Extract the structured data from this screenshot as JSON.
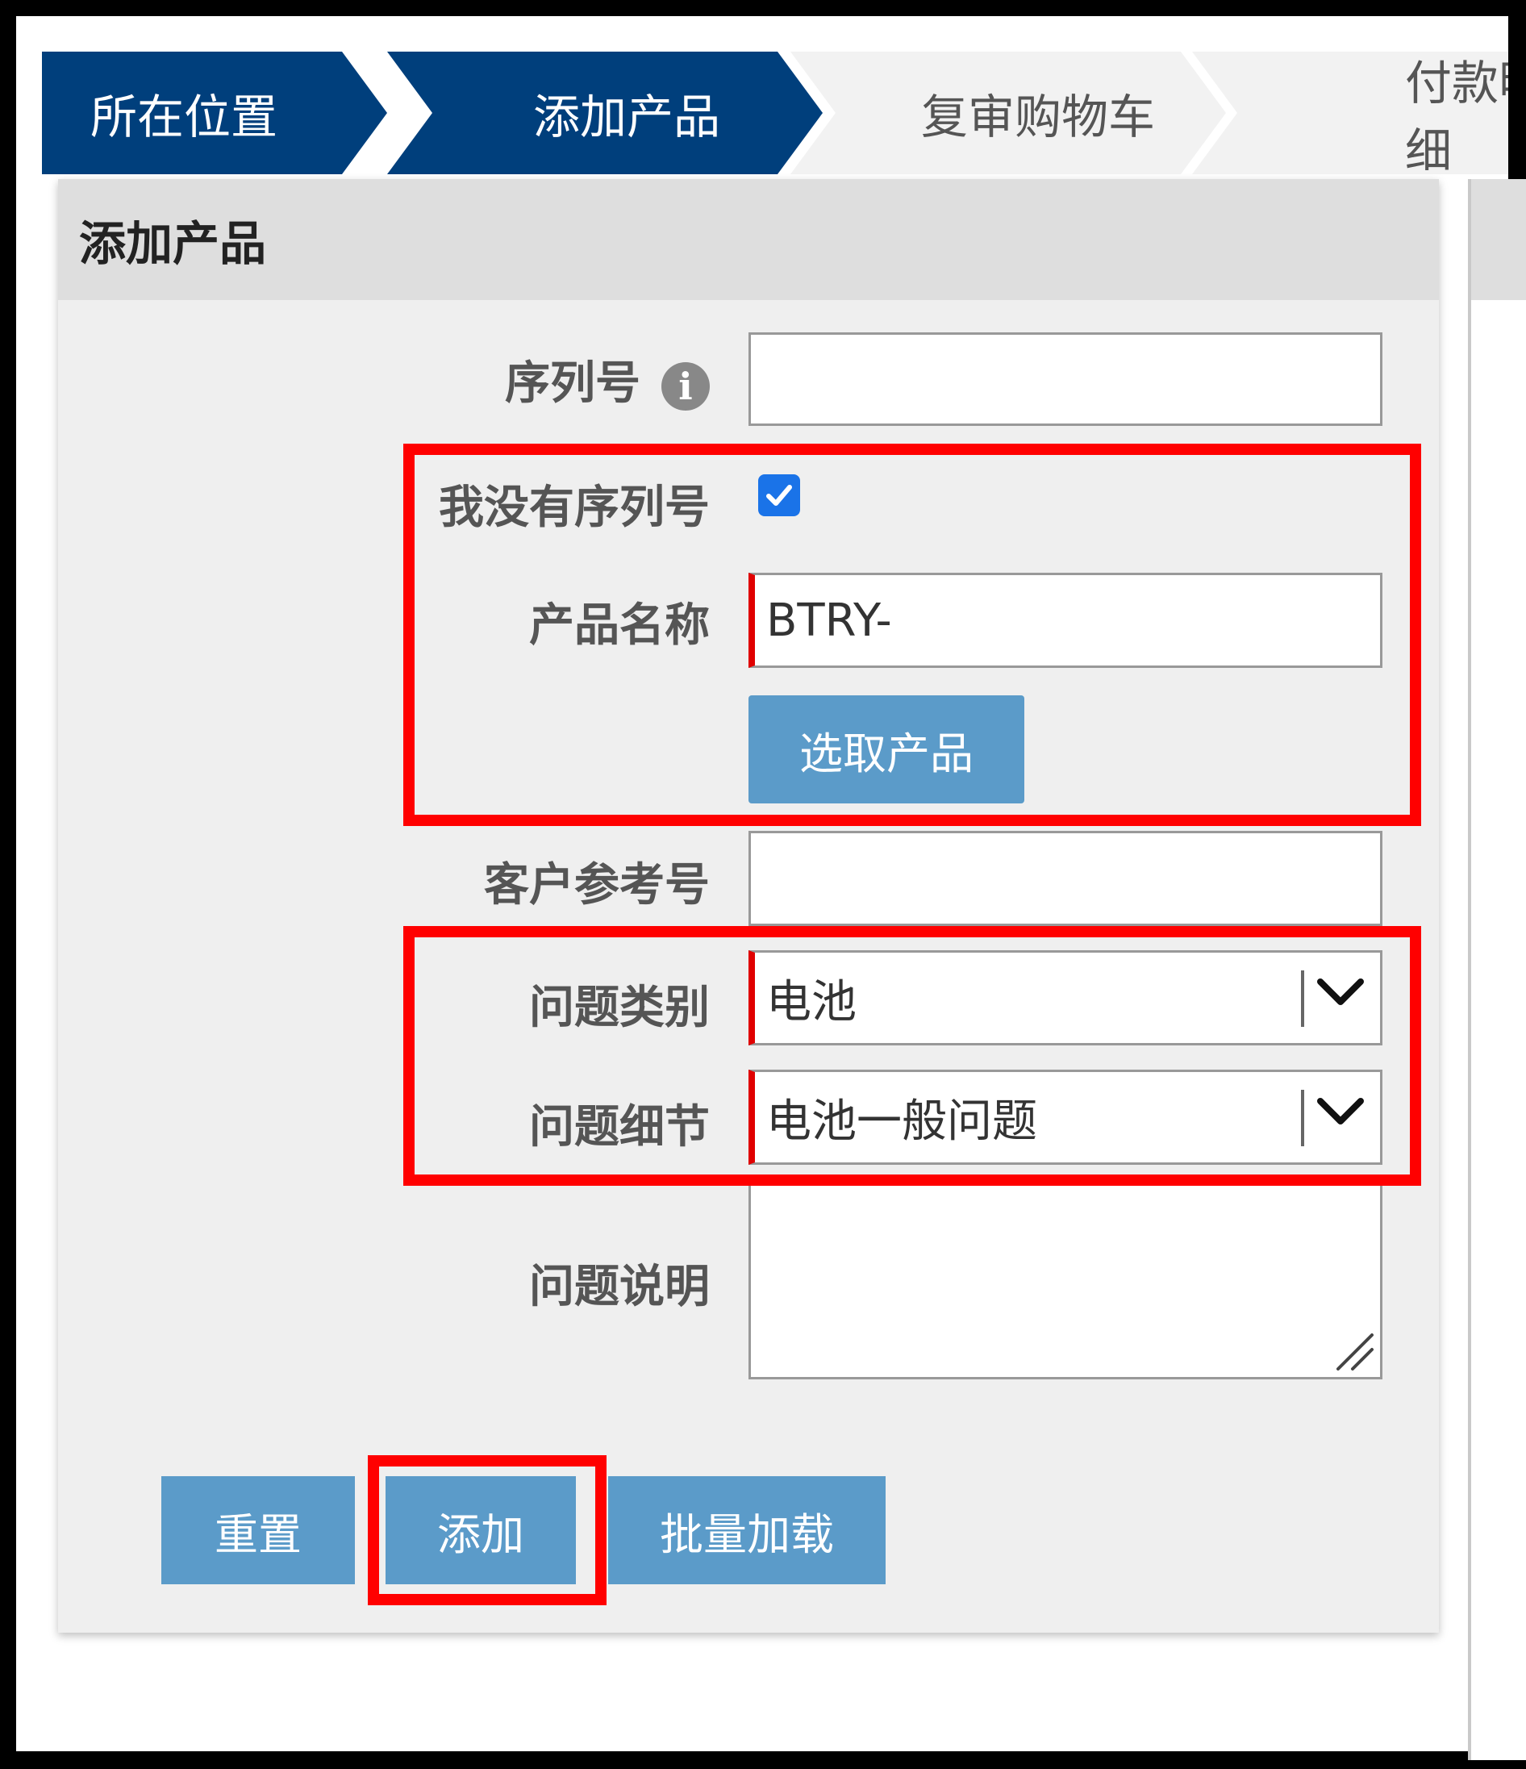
{
  "steps": [
    {
      "label": "所在位置",
      "state": "done"
    },
    {
      "label": "添加产品",
      "state": "current"
    },
    {
      "label": "复审购物车",
      "state": "todo"
    },
    {
      "label": "付款明细",
      "state": "todo"
    }
  ],
  "panel": {
    "title": "添加产品",
    "serial_label": "序列号",
    "serial_value": "",
    "no_serial_label": "我没有序列号",
    "no_serial_checked": true,
    "product_name_label": "产品名称",
    "product_name_value": "BTRY-",
    "select_product_button": "选取产品",
    "customer_ref_label": "客户参考号",
    "customer_ref_value": "",
    "issue_category_label": "问题类别",
    "issue_category_value": "电池",
    "issue_detail_label": "问题细节",
    "issue_detail_value": "电池一般问题",
    "issue_desc_label": "问题说明",
    "issue_desc_value": "",
    "reset_button": "重置",
    "add_button": "添加",
    "bulk_load_button": "批量加载"
  },
  "colors": {
    "step_done": "#003f7c",
    "button": "#5b9bc9",
    "highlight": "#ff0000",
    "required_marker": "#e00000",
    "checkbox": "#1a73e8"
  },
  "icons": [
    "info-icon",
    "checkmark-icon",
    "chevron-down-icon",
    "resize-grip-icon"
  ]
}
